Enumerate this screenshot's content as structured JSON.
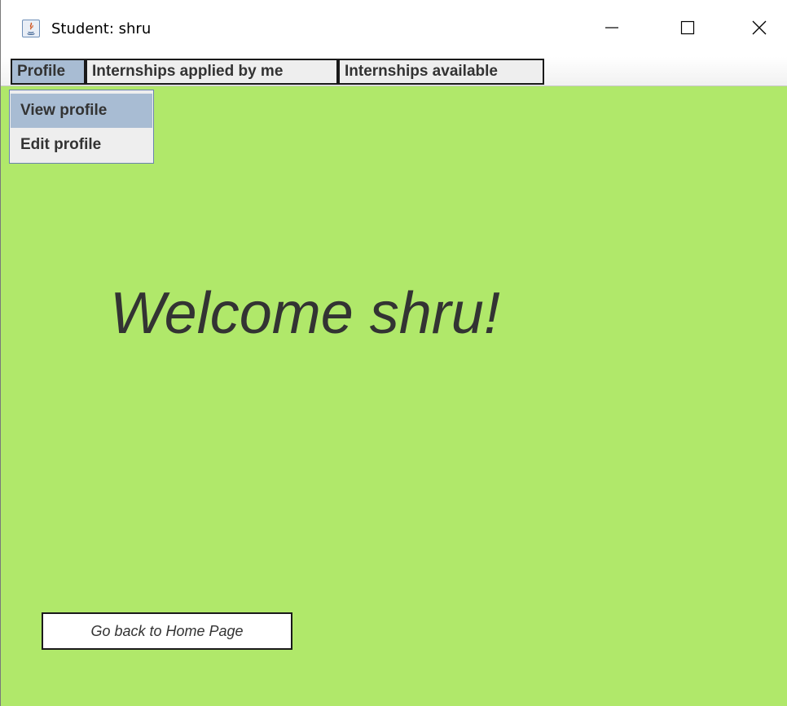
{
  "window": {
    "title": "Student: shru",
    "icon": "java-app-icon"
  },
  "window_controls": {
    "minimize": "minimize-icon",
    "maximize": "maximize-icon",
    "close": "close-icon"
  },
  "menubar": {
    "items": [
      {
        "label": "Profile",
        "active": true
      },
      {
        "label": "Internships applied by me",
        "active": false
      },
      {
        "label": "Internships available",
        "active": false
      }
    ]
  },
  "dropdown": {
    "items": [
      {
        "label": "View profile",
        "highlighted": true
      },
      {
        "label": "Edit profile",
        "highlighted": false
      }
    ]
  },
  "main": {
    "welcome": "Welcome shru!",
    "home_button": "Go back to Home Page"
  },
  "colors": {
    "content_background": "#b0e86a",
    "menu_active": "#a8bcd3",
    "text": "#333333"
  }
}
